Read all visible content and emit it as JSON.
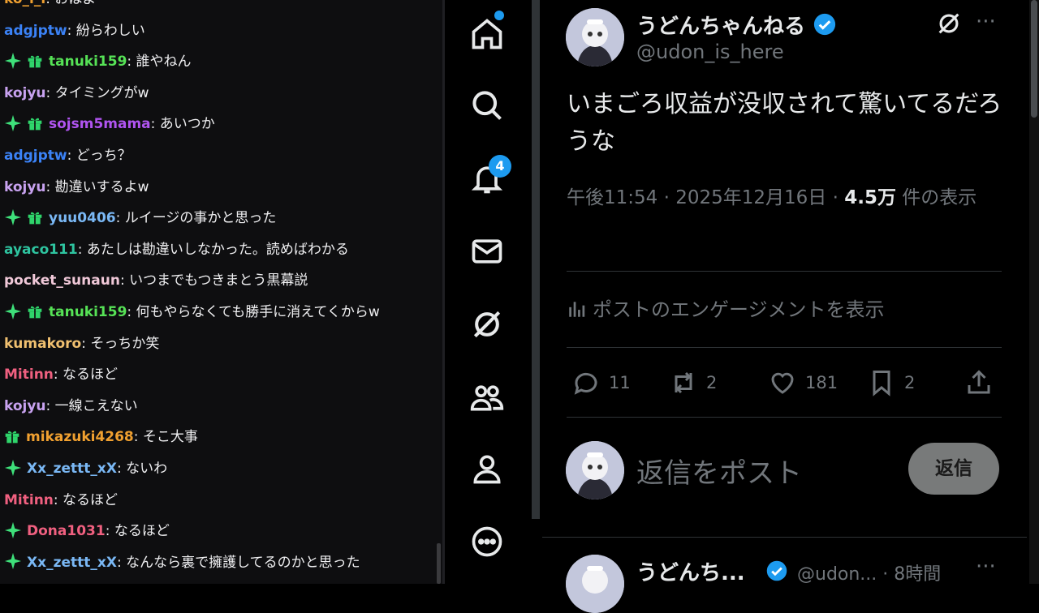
{
  "chat": {
    "messages": [
      {
        "user": "ko_i_i",
        "color": "#f0a030",
        "text": "おはよ",
        "star": false,
        "gift": false
      },
      {
        "user": "adgjptw",
        "color": "#3b82f6",
        "text": "紛らわしい",
        "star": false,
        "gift": false
      },
      {
        "user": "tanuki159",
        "color": "#56e256",
        "text": "誰やねん",
        "star": true,
        "gift": true
      },
      {
        "user": "kojyu",
        "color": "#c8a2f0",
        "text": "タイミングがw",
        "star": false,
        "gift": false
      },
      {
        "user": "sojsm5mama",
        "color": "#b054f0",
        "text": "あいつか",
        "star": true,
        "gift": true
      },
      {
        "user": "adgjptw",
        "color": "#3b82f6",
        "text": "どっち？",
        "star": false,
        "gift": false
      },
      {
        "user": "kojyu",
        "color": "#c8a2f0",
        "text": "勘違いするよw",
        "star": false,
        "gift": false
      },
      {
        "user": "yuu0406",
        "color": "#7ab8f5",
        "text": "ルイージの事かと思った",
        "star": true,
        "gift": true
      },
      {
        "user": "ayaco111",
        "color": "#2ec4a0",
        "text": "あたしは勘違いしなかった。読めばわかる",
        "star": false,
        "gift": false
      },
      {
        "user": "pocket_sunaun",
        "color": "#f0c8d8",
        "text": "いつまでもつきまとう黒幕説",
        "star": false,
        "gift": false
      },
      {
        "user": "tanuki159",
        "color": "#56e256",
        "text": "何もやらなくても勝手に消えてくからw",
        "star": true,
        "gift": true
      },
      {
        "user": "kumakoro",
        "color": "#f0c070",
        "text": "そっちか笑",
        "star": false,
        "gift": false
      },
      {
        "user": "Mitinn",
        "color": "#f06080",
        "text": "なるほど",
        "star": false,
        "gift": false
      },
      {
        "user": "kojyu",
        "color": "#c8a2f0",
        "text": "一線こえない",
        "star": false,
        "gift": false
      },
      {
        "user": "mikazuki4268",
        "color": "#f0a030",
        "text": "そこ大事",
        "star": false,
        "gift": true
      },
      {
        "user": "Xx_zettt_xX",
        "color": "#7ab8f5",
        "text": "ないわ",
        "star": true,
        "gift": false
      },
      {
        "user": "Mitinn",
        "color": "#f06080",
        "text": "なるほど",
        "star": false,
        "gift": false
      },
      {
        "user": "Dona1031",
        "color": "#f06080",
        "text": "なるほど",
        "star": true,
        "gift": false
      },
      {
        "user": "Xx_zettt_xX",
        "color": "#7ab8f5",
        "text": "なんなら裏で擁護してるのかと思った",
        "star": true,
        "gift": false
      }
    ]
  },
  "nav": {
    "notification_count": "4"
  },
  "post": {
    "author_name": "うどんちゃんねる",
    "author_handle": "@udon_is_here",
    "text": "いまごろ収益が没収されて驚いてるだろうな",
    "time": "午後11:54 · 2025年12月16日 · ",
    "views": "4.5万",
    "views_suffix": " 件の表示",
    "engagement_label": "ポストのエンゲージメントを表示",
    "replies": "11",
    "reposts": "2",
    "likes": "181",
    "bookmarks": "2"
  },
  "reply_box": {
    "placeholder": "返信をポスト",
    "button": "返信"
  },
  "next_post": {
    "author_name": "うどんち...",
    "handle_time": "@udon... · 8時間"
  },
  "colors": {
    "accent": "#1d9bf0",
    "star_badge": "#3ee07a",
    "gift_badge": "#2fd56b"
  }
}
